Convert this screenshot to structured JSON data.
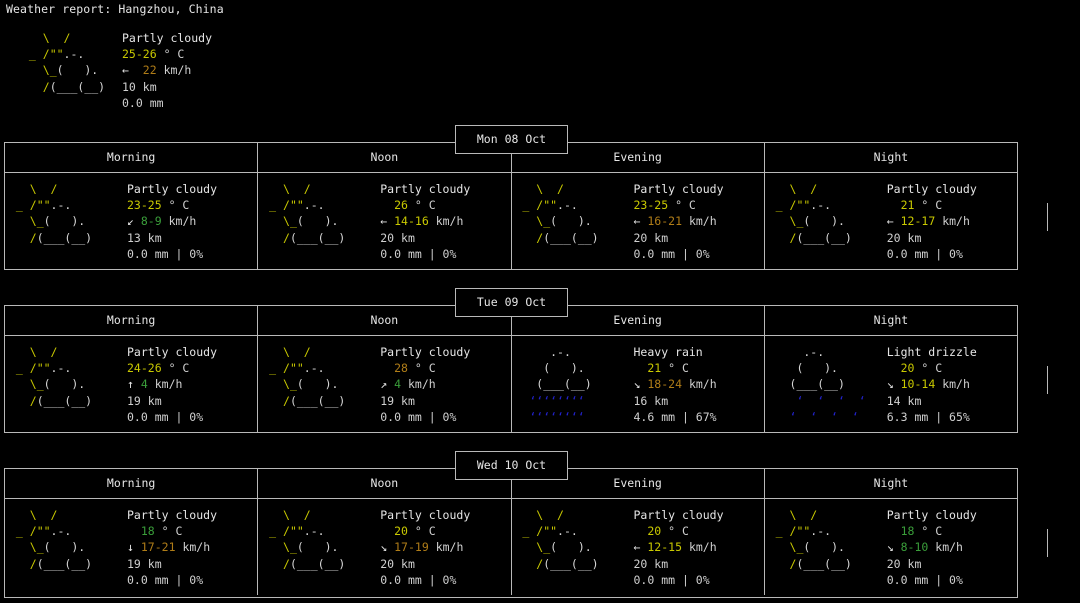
{
  "title": "Weather report: Hangzhou, China",
  "current": {
    "icon_name": "partly-cloudy-icon",
    "art": [
      {
        "sun": "   \\  /",
        "cloud": ""
      },
      {
        "sun": " _ /\"\"",
        "cloud": ".-."
      },
      {
        "sun": "   \\_(",
        "cloud": "   )."
      },
      {
        "sun": "   /(",
        "cloud": "___(__)"
      }
    ],
    "condition": "Partly cloudy",
    "temperature": "25-26",
    "temperature_unit": "° C",
    "wind_arrow": "←",
    "wind": "22",
    "wind_unit": "km/h",
    "visibility": "10 km",
    "precipitation": "0.0 mm"
  },
  "columns": [
    "Morning",
    "Noon",
    "Evening",
    "Night"
  ],
  "days": [
    {
      "label": "Mon 08 Oct",
      "cells": [
        {
          "period": "Morning",
          "icon_name": "partly-cloudy-icon",
          "condition": "Partly cloudy",
          "temperature": "23-25",
          "temp_color": "yellow",
          "temperature_unit": "° C",
          "wind_arrow": "↙",
          "wind": "8-9",
          "wind_color": "green",
          "wind_unit": "km/h",
          "visibility": "13 km",
          "precipitation": "0.0 mm",
          "chance": "0%"
        },
        {
          "period": "Noon",
          "icon_name": "partly-cloudy-icon",
          "condition": "Partly cloudy",
          "temperature": "26",
          "temp_color": "yellow",
          "temperature_unit": "° C",
          "wind_arrow": "←",
          "wind": "14-16",
          "wind_color": "yellow",
          "wind_unit": "km/h",
          "visibility": "20 km",
          "precipitation": "0.0 mm",
          "chance": "0%"
        },
        {
          "period": "Evening",
          "icon_name": "partly-cloudy-icon",
          "condition": "Partly cloudy",
          "temperature": "23-25",
          "temp_color": "yellow",
          "temperature_unit": "° C",
          "wind_arrow": "←",
          "wind": "16-21",
          "wind_color": "orange",
          "wind_unit": "km/h",
          "visibility": "20 km",
          "precipitation": "0.0 mm",
          "chance": "0%"
        },
        {
          "period": "Night",
          "icon_name": "partly-cloudy-icon",
          "condition": "Partly cloudy",
          "temperature": "21",
          "temp_color": "yellow",
          "temperature_unit": "° C",
          "wind_arrow": "←",
          "wind": "12-17",
          "wind_color": "yellow",
          "wind_unit": "km/h",
          "visibility": "20 km",
          "precipitation": "0.0 mm",
          "chance": "0%"
        }
      ]
    },
    {
      "label": "Tue 09 Oct",
      "cells": [
        {
          "period": "Morning",
          "icon_name": "partly-cloudy-icon",
          "condition": "Partly cloudy",
          "temperature": "24-26",
          "temp_color": "yellow",
          "temperature_unit": "° C",
          "wind_arrow": "↑",
          "wind": "4",
          "wind_color": "green",
          "wind_unit": "km/h",
          "visibility": "19 km",
          "precipitation": "0.0 mm",
          "chance": "0%"
        },
        {
          "period": "Noon",
          "icon_name": "partly-cloudy-icon",
          "condition": "Partly cloudy",
          "temperature": "28",
          "temp_color": "orange",
          "temperature_unit": "° C",
          "wind_arrow": "↗",
          "wind": "4",
          "wind_color": "green",
          "wind_unit": "km/h",
          "visibility": "19 km",
          "precipitation": "0.0 mm",
          "chance": "0%"
        },
        {
          "period": "Evening",
          "icon_name": "heavy-rain-icon",
          "condition": "Heavy rain",
          "temperature": "21",
          "temp_color": "yellow",
          "temperature_unit": "° C",
          "wind_arrow": "↘",
          "wind": "18-24",
          "wind_color": "orange",
          "wind_unit": "km/h",
          "visibility": "16 km",
          "precipitation": "4.6 mm",
          "chance": "67%"
        },
        {
          "period": "Night",
          "icon_name": "light-drizzle-icon",
          "condition": "Light drizzle",
          "temperature": "20",
          "temp_color": "yellow",
          "temperature_unit": "° C",
          "wind_arrow": "↘",
          "wind": "10-14",
          "wind_color": "yellow",
          "wind_unit": "km/h",
          "visibility": "14 km",
          "precipitation": "6.3 mm",
          "chance": "65%"
        }
      ]
    },
    {
      "label": "Wed 10 Oct",
      "cells": [
        {
          "period": "Morning",
          "icon_name": "partly-cloudy-icon",
          "condition": "Partly cloudy",
          "temperature": "18",
          "temp_color": "green",
          "temperature_unit": "° C",
          "wind_arrow": "↓",
          "wind": "17-21",
          "wind_color": "orange",
          "wind_unit": "km/h",
          "visibility": "19 km",
          "precipitation": "0.0 mm",
          "chance": "0%"
        },
        {
          "period": "Noon",
          "icon_name": "partly-cloudy-icon",
          "condition": "Partly cloudy",
          "temperature": "20",
          "temp_color": "yellow",
          "temperature_unit": "° C",
          "wind_arrow": "↘",
          "wind": "17-19",
          "wind_color": "orange",
          "wind_unit": "km/h",
          "visibility": "20 km",
          "precipitation": "0.0 mm",
          "chance": "0%"
        },
        {
          "period": "Evening",
          "icon_name": "partly-cloudy-icon",
          "condition": "Partly cloudy",
          "temperature": "20",
          "temp_color": "yellow",
          "temperature_unit": "° C",
          "wind_arrow": "←",
          "wind": "12-15",
          "wind_color": "yellow",
          "wind_unit": "km/h",
          "visibility": "20 km",
          "precipitation": "0.0 mm",
          "chance": "0%"
        },
        {
          "period": "Night",
          "icon_name": "partly-cloudy-icon",
          "condition": "Partly cloudy",
          "temperature": "18",
          "temp_color": "green",
          "temperature_unit": "° C",
          "wind_arrow": "↘",
          "wind": "8-10",
          "wind_color": "green",
          "wind_unit": "km/h",
          "visibility": "20 km",
          "precipitation": "0.0 mm",
          "chance": "0%"
        }
      ]
    }
  ],
  "ascii": {
    "partly_cloudy": [
      "   \\  /",
      " _ /\"\".-.",
      "   \\_(   ).",
      "   /(___(__)"
    ],
    "rain_cloud": [
      "     .-.",
      "    (   ).",
      "   (___(__)",
      ""
    ],
    "heavy_rain_drops": [
      "  ‘‘‘‘‘‘‘‘",
      "  ‘‘‘‘‘‘‘‘"
    ],
    "light_drizzle_drops": [
      "   ‘ ‘ ‘ ‘",
      "  ‘ ‘ ‘ ‘"
    ]
  },
  "colors": {
    "background": "#000000",
    "border": "#b9b9b9",
    "text": "#d0d0d0",
    "text_bright": "#e6e6e6",
    "sun_yellow": "#c9c900",
    "temp_yellow": "#c9c900",
    "temp_green": "#3a9e3a",
    "temp_orange": "#b07d18",
    "wind_green": "#3a9e3a",
    "wind_yellow": "#c9c900",
    "wind_orange": "#b07d18",
    "rain_blue": "#2222cc"
  }
}
